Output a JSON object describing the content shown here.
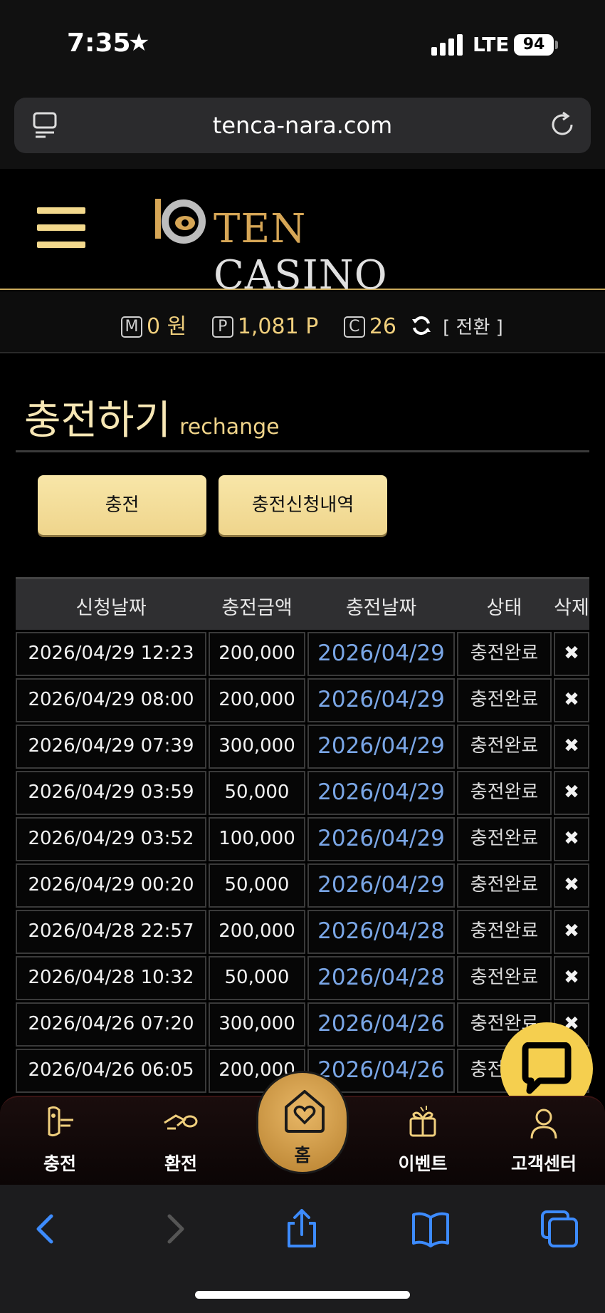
{
  "status_bar": {
    "time": "7:35",
    "network": "LTE",
    "battery": "94"
  },
  "browser": {
    "url": "tenca-nara.com"
  },
  "site": {
    "logo_text_1": "TEN",
    "logo_text_2": "CASINO"
  },
  "balance": {
    "money_badge": "M",
    "money": "0 원",
    "point_badge": "P",
    "points": "1,081 P",
    "coin_badge": "C",
    "coins": "26",
    "convert_label": "[ 전환 ]"
  },
  "page": {
    "title": "충전하기",
    "subtitle": "rechange"
  },
  "buttons": {
    "charge": "충전",
    "history": "충전신청내역"
  },
  "table": {
    "headers": [
      "신청날짜",
      "충전금액",
      "충전날짜",
      "상태",
      "삭제"
    ],
    "rows": [
      {
        "requested": "2026/04/29 12:23",
        "amount": "200,000",
        "charged": "2026/04/29",
        "status": "충전완료",
        "delete": "✖"
      },
      {
        "requested": "2026/04/29 08:00",
        "amount": "200,000",
        "charged": "2026/04/29",
        "status": "충전완료",
        "delete": "✖"
      },
      {
        "requested": "2026/04/29 07:39",
        "amount": "300,000",
        "charged": "2026/04/29",
        "status": "충전완료",
        "delete": "✖"
      },
      {
        "requested": "2026/04/29 03:59",
        "amount": "50,000",
        "charged": "2026/04/29",
        "status": "충전완료",
        "delete": "✖"
      },
      {
        "requested": "2026/04/29 03:52",
        "amount": "100,000",
        "charged": "2026/04/29",
        "status": "충전완료",
        "delete": "✖"
      },
      {
        "requested": "2026/04/29 00:20",
        "amount": "50,000",
        "charged": "2026/04/29",
        "status": "충전완료",
        "delete": "✖"
      },
      {
        "requested": "2026/04/28 22:57",
        "amount": "200,000",
        "charged": "2026/04/28",
        "status": "충전완료",
        "delete": "✖"
      },
      {
        "requested": "2026/04/28 10:32",
        "amount": "50,000",
        "charged": "2026/04/28",
        "status": "충전완료",
        "delete": "✖"
      },
      {
        "requested": "2026/04/26 07:20",
        "amount": "300,000",
        "charged": "2026/04/26",
        "status": "충전완료",
        "delete": "✖"
      },
      {
        "requested": "2026/04/26 06:05",
        "amount": "200,000",
        "charged": "2026/04/26",
        "status": "충전완료",
        "delete": "✖"
      }
    ]
  },
  "bottom_nav": {
    "charge": "충전",
    "exchange": "환전",
    "home": "홈",
    "event": "이벤트",
    "support": "고객센터"
  },
  "colors": {
    "gold": "#f0cf7d",
    "link_blue": "#7aa6e6",
    "chat_yellow": "#f5cf4f"
  }
}
